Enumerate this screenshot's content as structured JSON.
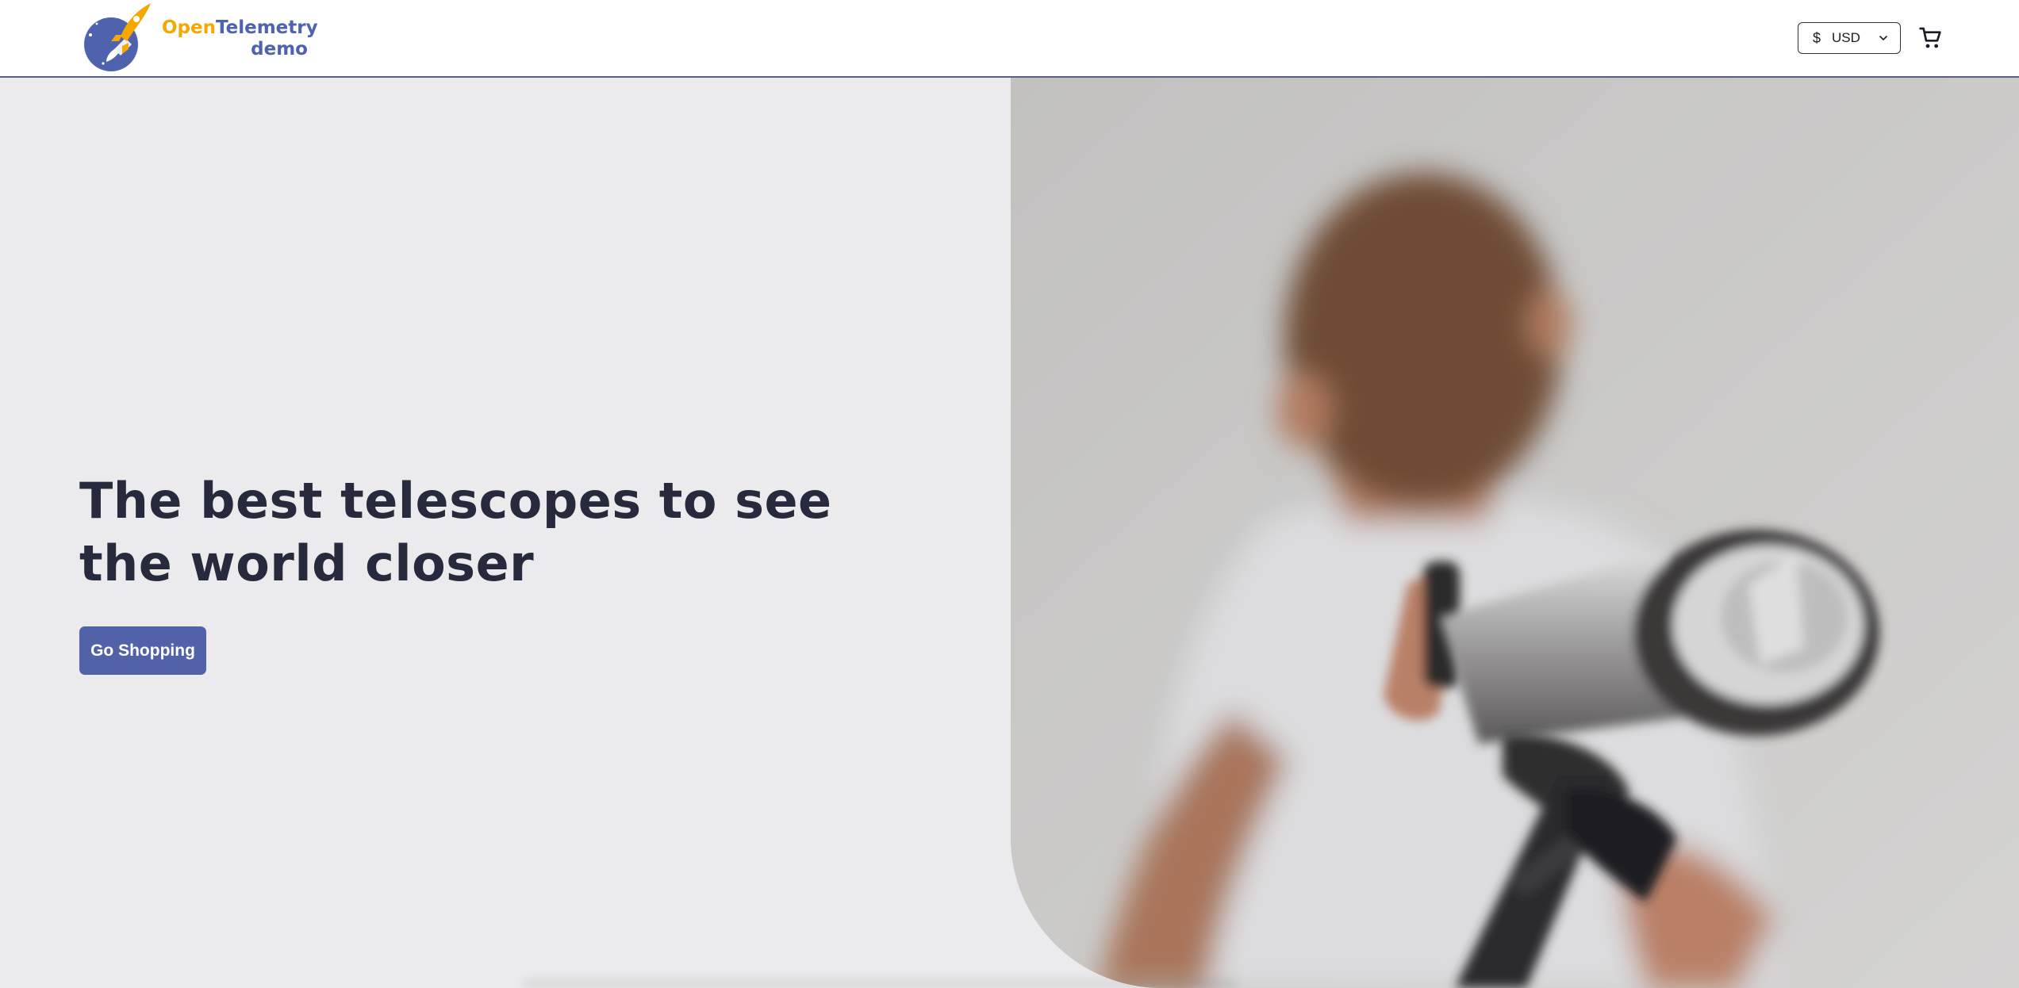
{
  "header": {
    "logo": {
      "text_open": "Open",
      "text_telemetry": "Telemetry",
      "text_demo": "demo",
      "icon": "rocket-globe-logo-icon"
    },
    "currency": {
      "symbol": "$",
      "selected": "USD",
      "icon": "chevron-down-icon"
    },
    "cart": {
      "icon": "shopping-cart-icon"
    }
  },
  "hero": {
    "title": "The best telescopes to see the world closer",
    "cta_label": "Go Shopping",
    "image": "boy-looking-through-telescope-photo"
  },
  "colors": {
    "brand_blue": "#4f62ad",
    "brand_orange": "#f5a800",
    "button_bg": "#5262a9",
    "title_text": "#272a3d",
    "page_bg": "#ebebed"
  }
}
